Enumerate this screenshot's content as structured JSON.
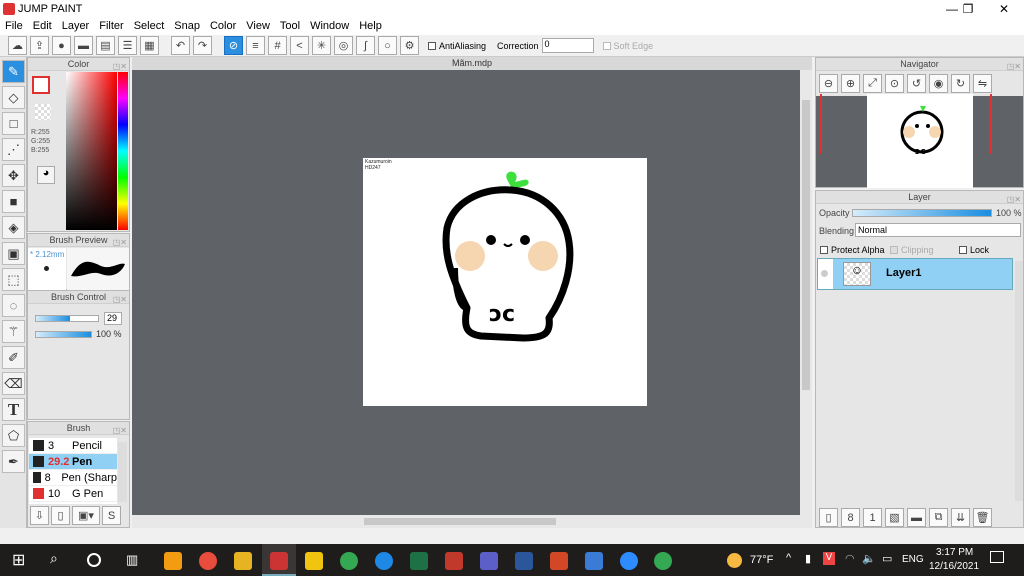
{
  "app": {
    "title": "JUMP PAINT",
    "win_min": "—",
    "win_restore": "❐",
    "win_close": "✕"
  },
  "menu": [
    "File",
    "Edit",
    "Layer",
    "Filter",
    "Select",
    "Snap",
    "Color",
    "View",
    "Tool",
    "Window",
    "Help"
  ],
  "toolbar": {
    "antialiasing": "AntiAliasing",
    "correction_label": "Correction",
    "correction_value": "0",
    "soft_edge": "Soft Edge"
  },
  "color_panel": {
    "title": "Color",
    "r": "R:255",
    "g": "G:255",
    "b": "B:255"
  },
  "brush_preview": {
    "title": "Brush Preview",
    "size": "* 2.12mm"
  },
  "brush_control": {
    "title": "Brush Control",
    "size_value": "29",
    "size_fraction": 0.55,
    "opacity": "100 %",
    "opacity_fraction": 1.0
  },
  "brush": {
    "title": "Brush",
    "items": [
      {
        "size": "3",
        "name": "Pencil",
        "color": "#222222"
      },
      {
        "size": "29.2",
        "name": "Pen",
        "color": "#222222",
        "selected": true
      },
      {
        "size": "8",
        "name": "Pen (Sharp",
        "color": "#222222"
      },
      {
        "size": "10",
        "name": "G Pen",
        "color": "#e03030"
      }
    ]
  },
  "document": {
    "tab": "Mãm.mdp"
  },
  "navigator": {
    "title": "Navigator"
  },
  "layer_panel": {
    "title": "Layer",
    "opacity_label": "Opacity",
    "opacity_value": "100 %",
    "blending_label": "Blending",
    "blending_value": "Normal",
    "protect_alpha": "Protect Alpha",
    "clipping": "Clipping",
    "lock": "Lock",
    "layers": [
      {
        "name": "Layer1"
      }
    ]
  },
  "taskbar": {
    "weather": "77°F",
    "lang": "ENG",
    "time": "3:17 PM",
    "date": "12/16/2021"
  }
}
